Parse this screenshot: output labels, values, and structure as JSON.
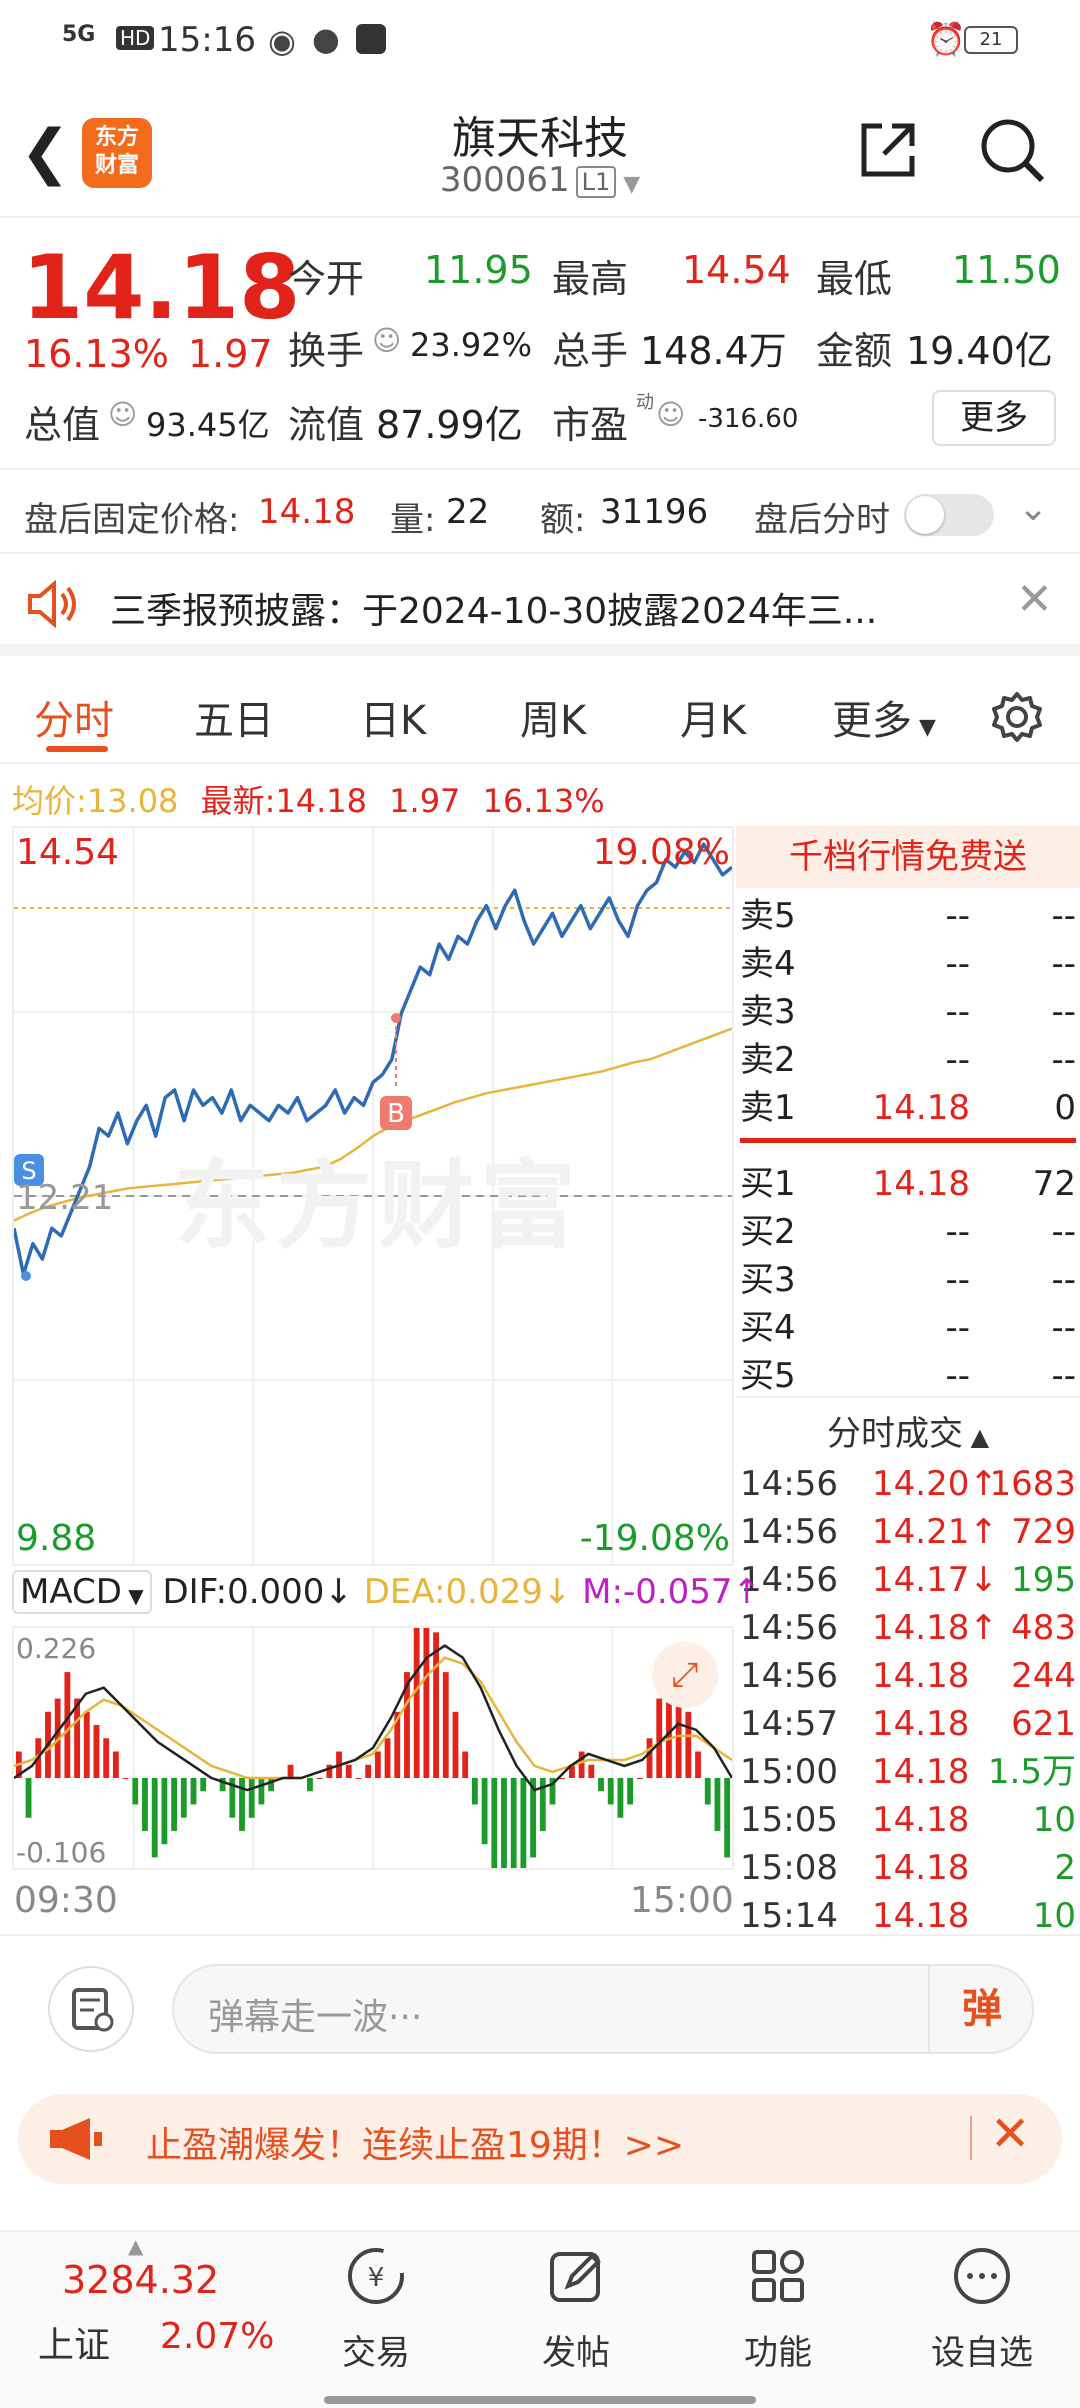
{
  "status_bar": {
    "signal": "5G",
    "hd": "HD",
    "time": "15:16",
    "battery": "21"
  },
  "header": {
    "logo_line1": "东方",
    "logo_line2": "财富",
    "title": "旗天科技",
    "code": "300061",
    "level": "L1"
  },
  "quote": {
    "price": "14.18",
    "change_pct": "16.13%",
    "change": "1.97",
    "open_label": "今开",
    "open": "11.95",
    "high_label": "最高",
    "high": "14.54",
    "low_label": "最低",
    "low": "11.50",
    "turnover_label": "换手",
    "turnover": "23.92%",
    "volume_label": "总手",
    "volume": "148.4万",
    "amount_label": "金额",
    "amount": "19.40亿",
    "mcap_label": "总值",
    "mcap": "93.45亿",
    "float_label": "流值",
    "float": "87.99亿",
    "pe_label": "市盈",
    "pe_sup": "动",
    "pe": "-316.60",
    "more_label": "更多"
  },
  "after_hours": {
    "price_label": "盘后固定价格:",
    "price": "14.18",
    "vol_label": "量:",
    "vol": "22",
    "amt_label": "额:",
    "amt": "31196",
    "timeshare_label": "盘后分时"
  },
  "notice": {
    "text": "三季报预披露：于2024-10-30披露2024年三..."
  },
  "tabs": [
    "分时",
    "五日",
    "日K",
    "周K",
    "月K",
    "更多"
  ],
  "chart_info": {
    "avg_label": "均价:",
    "avg": "13.08",
    "latest_label": "最新:",
    "latest": "14.18",
    "change": "1.97",
    "change_pct": "16.13%"
  },
  "chart_data": {
    "type": "line",
    "ylim": [
      9.88,
      14.54
    ],
    "top_left_label": "14.54",
    "top_right_label": "19.08%",
    "bottom_left_label": "9.88",
    "bottom_right_label": "-19.08%",
    "mid_label": "12.21",
    "x_start": "09:30",
    "x_end": "15:00",
    "watermark": "东方财富",
    "series": [
      {
        "values": [
          12.0,
          11.7,
          11.9,
          11.8,
          12.0,
          11.95,
          12.1,
          12.25,
          12.4,
          12.65,
          12.6,
          12.75,
          12.55,
          12.7,
          12.8,
          12.6,
          12.85,
          12.9,
          12.7,
          12.9,
          12.8,
          12.85,
          12.75,
          12.9,
          12.7,
          12.8,
          12.75,
          12.7,
          12.8,
          12.75,
          12.85,
          12.7,
          12.75,
          12.8,
          12.9,
          12.75,
          12.85,
          12.8,
          12.95,
          13.0,
          13.1,
          13.4,
          13.55,
          13.7,
          13.65,
          13.85,
          13.75,
          13.9,
          13.85,
          14.0,
          14.1,
          13.95,
          14.1,
          14.2,
          14.0,
          13.85,
          13.95,
          14.05,
          13.9,
          14.0,
          14.1,
          13.95,
          14.05,
          14.15,
          14.0,
          13.9,
          14.1,
          14.2,
          14.25,
          14.4,
          14.35,
          14.45,
          14.38,
          14.5,
          14.4,
          14.3,
          14.35
        ]
      },
      {
        "values": [
          12.05,
          12.1,
          12.14,
          12.17,
          12.2,
          12.22,
          12.24,
          12.26,
          12.27,
          12.28,
          12.29,
          12.3,
          12.31,
          12.32,
          12.33,
          12.34,
          12.35,
          12.36,
          12.38,
          12.4,
          12.45,
          12.52,
          12.6,
          12.66,
          12.7,
          12.74,
          12.78,
          12.82,
          12.85,
          12.88,
          12.9,
          12.92,
          12.94,
          12.96,
          12.98,
          13.0,
          13.02,
          13.05,
          13.08,
          13.1,
          13.14,
          13.18,
          13.22,
          13.26,
          13.3
        ]
      }
    ],
    "buy_marker": "B",
    "sell_marker": "S"
  },
  "macd": {
    "label": "MACD",
    "dif": "DIF:0.000",
    "dea": "DEA:0.029",
    "m": "M:-0.057",
    "max_label": "0.226",
    "min_label": "-0.106",
    "bars": [
      0.02,
      -0.03,
      0.03,
      0.05,
      0.06,
      0.08,
      0.06,
      0.05,
      0.04,
      0.03,
      0.02,
      0.0,
      -0.02,
      -0.04,
      -0.06,
      -0.05,
      -0.04,
      -0.03,
      -0.02,
      -0.01,
      0.0,
      -0.01,
      -0.03,
      -0.04,
      -0.03,
      -0.02,
      -0.01,
      0.0,
      0.01,
      0.0,
      -0.01,
      0.0,
      0.01,
      0.02,
      0.01,
      0.0,
      0.01,
      0.02,
      0.03,
      0.05,
      0.08,
      0.12,
      0.15,
      0.11,
      0.08,
      0.05,
      0.02,
      -0.02,
      -0.05,
      -0.07,
      -0.08,
      -0.1,
      -0.08,
      -0.06,
      -0.04,
      -0.02,
      0.0,
      0.01,
      0.02,
      0.01,
      -0.01,
      -0.02,
      -0.03,
      -0.02,
      0.0,
      0.03,
      0.06,
      0.08,
      0.07,
      0.05,
      0.02,
      -0.02,
      -0.04,
      -0.06
    ],
    "dif_line": [
      0.0,
      0.02,
      0.06,
      0.1,
      0.14,
      0.15,
      0.12,
      0.09,
      0.06,
      0.04,
      0.02,
      0.0,
      -0.01,
      -0.02,
      -0.01,
      0.0,
      0.0,
      0.01,
      0.02,
      0.03,
      0.05,
      0.1,
      0.16,
      0.2,
      0.22,
      0.2,
      0.15,
      0.08,
      0.02,
      -0.02,
      -0.01,
      0.02,
      0.04,
      0.03,
      0.02,
      0.03,
      0.06,
      0.09,
      0.08,
      0.05,
      0.0
    ],
    "dea_line": [
      0.02,
      0.03,
      0.05,
      0.08,
      0.11,
      0.13,
      0.12,
      0.1,
      0.08,
      0.06,
      0.04,
      0.02,
      0.01,
      0.0,
      0.0,
      0.0,
      0.0,
      0.01,
      0.02,
      0.03,
      0.04,
      0.08,
      0.13,
      0.17,
      0.2,
      0.19,
      0.16,
      0.11,
      0.06,
      0.02,
      0.01,
      0.02,
      0.03,
      0.03,
      0.03,
      0.04,
      0.06,
      0.07,
      0.07,
      0.05,
      0.03
    ]
  },
  "order_book": {
    "banner": "千档行情免费送",
    "asks": [
      {
        "label": "卖5",
        "price": "--",
        "vol": "--"
      },
      {
        "label": "卖4",
        "price": "--",
        "vol": "--"
      },
      {
        "label": "卖3",
        "price": "--",
        "vol": "--"
      },
      {
        "label": "卖2",
        "price": "--",
        "vol": "--"
      },
      {
        "label": "卖1",
        "price": "14.18",
        "vol": "0"
      }
    ],
    "bids": [
      {
        "label": "买1",
        "price": "14.18",
        "vol": "72"
      },
      {
        "label": "买2",
        "price": "--",
        "vol": "--"
      },
      {
        "label": "买3",
        "price": "--",
        "vol": "--"
      },
      {
        "label": "买4",
        "price": "--",
        "vol": "--"
      },
      {
        "label": "买5",
        "price": "--",
        "vol": "--"
      }
    ]
  },
  "trades": {
    "title": "分时成交",
    "rows": [
      {
        "time": "14:56",
        "price": "14.20",
        "arrow": "↑",
        "vol": "1683",
        "color": "red"
      },
      {
        "time": "14:56",
        "price": "14.21",
        "arrow": "↑",
        "vol": "729",
        "color": "red"
      },
      {
        "time": "14:56",
        "price": "14.17",
        "arrow": "↓",
        "vol": "195",
        "color": "green"
      },
      {
        "time": "14:56",
        "price": "14.18",
        "arrow": "↑",
        "vol": "483",
        "color": "red"
      },
      {
        "time": "14:56",
        "price": "14.18",
        "arrow": "",
        "vol": "244",
        "color": "red"
      },
      {
        "time": "14:57",
        "price": "14.18",
        "arrow": "",
        "vol": "621",
        "color": "red"
      },
      {
        "time": "15:00",
        "price": "14.18",
        "arrow": "",
        "vol": "1.5万",
        "color": "green"
      },
      {
        "time": "15:05",
        "price": "14.18",
        "arrow": "",
        "vol": "10",
        "color": "green"
      },
      {
        "time": "15:08",
        "price": "14.18",
        "arrow": "",
        "vol": "2",
        "color": "green"
      },
      {
        "time": "15:14",
        "price": "14.18",
        "arrow": "",
        "vol": "10",
        "color": "green"
      }
    ]
  },
  "danmaku": {
    "placeholder": "弹幕走一波···",
    "send_label": "弹"
  },
  "promo": {
    "text": "止盈潮爆发！连续止盈19期！>>"
  },
  "bottom_nav": {
    "index_value": "3284.32",
    "index_name": "上证",
    "index_change": "2.07%",
    "items": [
      "交易",
      "发帖",
      "功能",
      "设自选"
    ]
  },
  "colors": {
    "red": "#e2231a",
    "green": "#1a9b2a",
    "orange": "#e5501e",
    "price_line": "#2e6bb5",
    "avg_line": "#e9b43b"
  }
}
